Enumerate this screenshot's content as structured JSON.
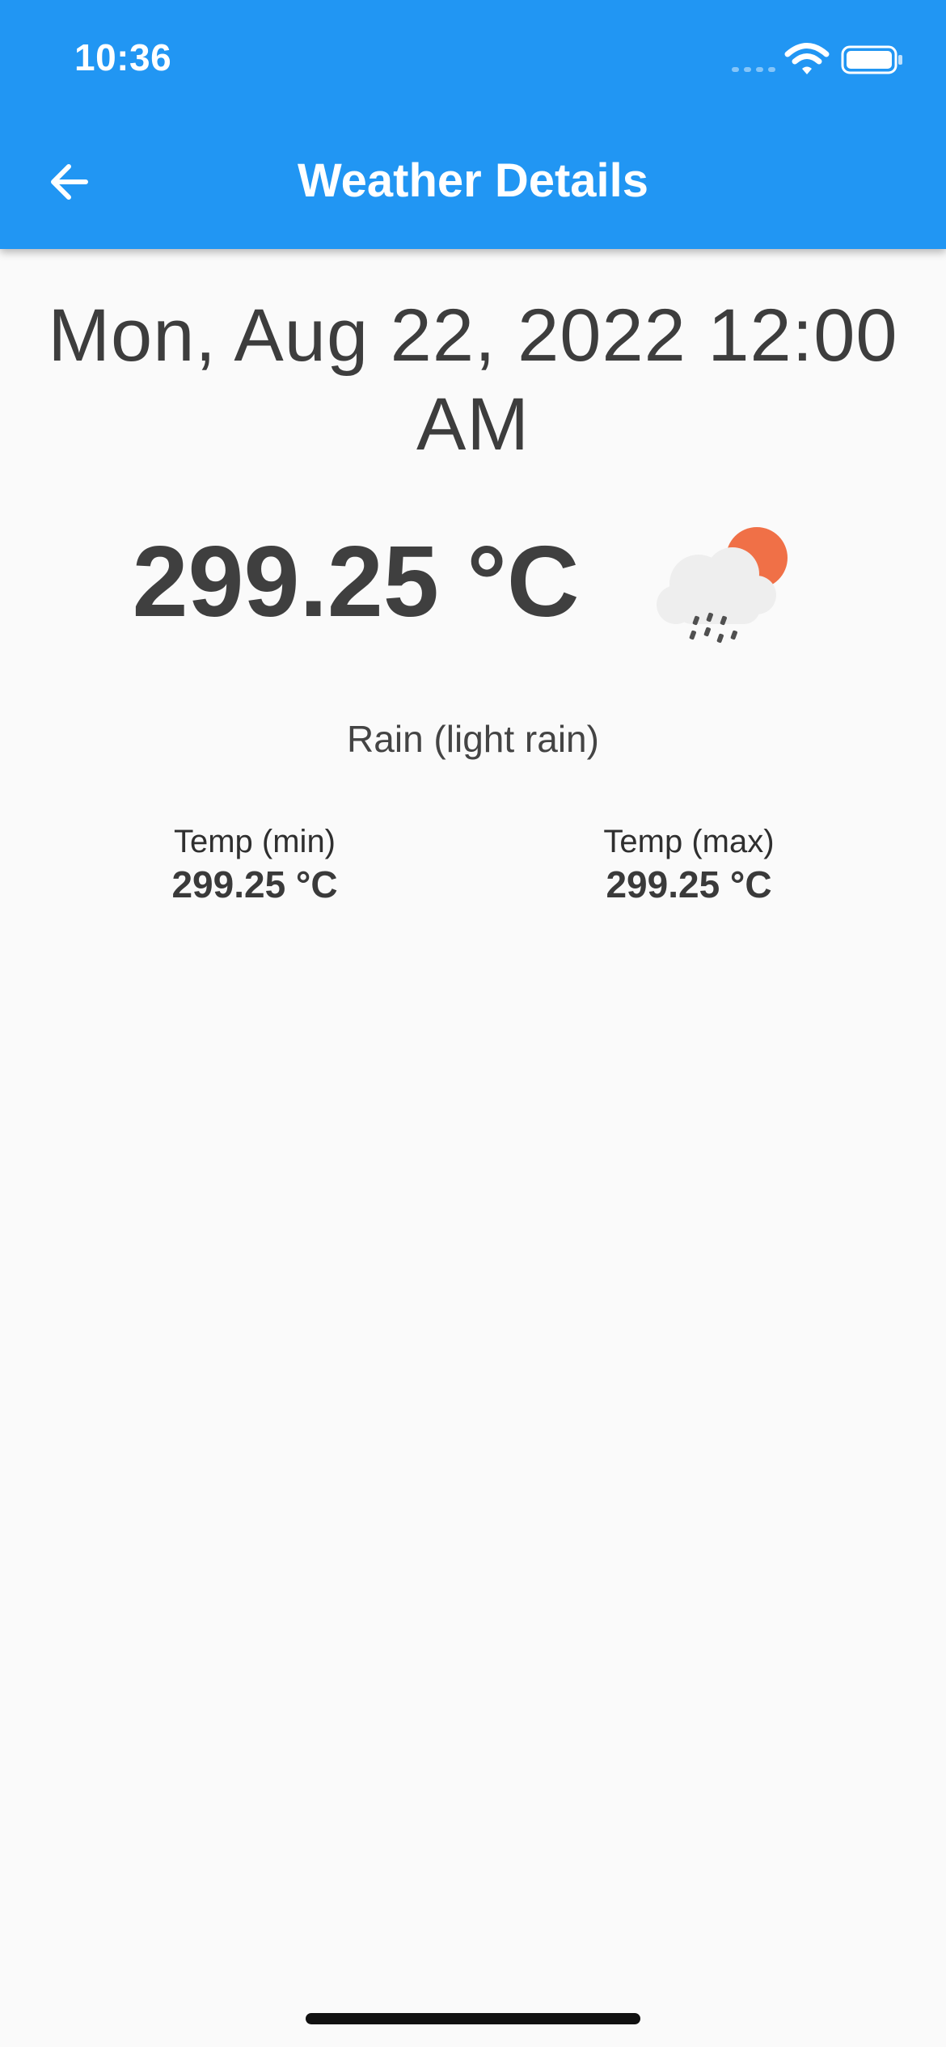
{
  "status_bar": {
    "time": "10:36"
  },
  "app_bar": {
    "title": "Weather Details",
    "back_icon": "arrow-back-icon",
    "background_color": "#2196f3"
  },
  "weather": {
    "datetime": "Mon, Aug 22, 2022 12:00 AM",
    "temperature": "299.25 °C",
    "icon": "rain-cloud-sun-icon",
    "condition": "Rain (light rain)",
    "temp_min_label": "Temp (min)",
    "temp_min_value": "299.25 °C",
    "temp_max_label": "Temp (max)",
    "temp_max_value": "299.25 °C"
  },
  "colors": {
    "background": "#fafafa",
    "sun": "#f07047",
    "cloud": "#eeeeee"
  }
}
